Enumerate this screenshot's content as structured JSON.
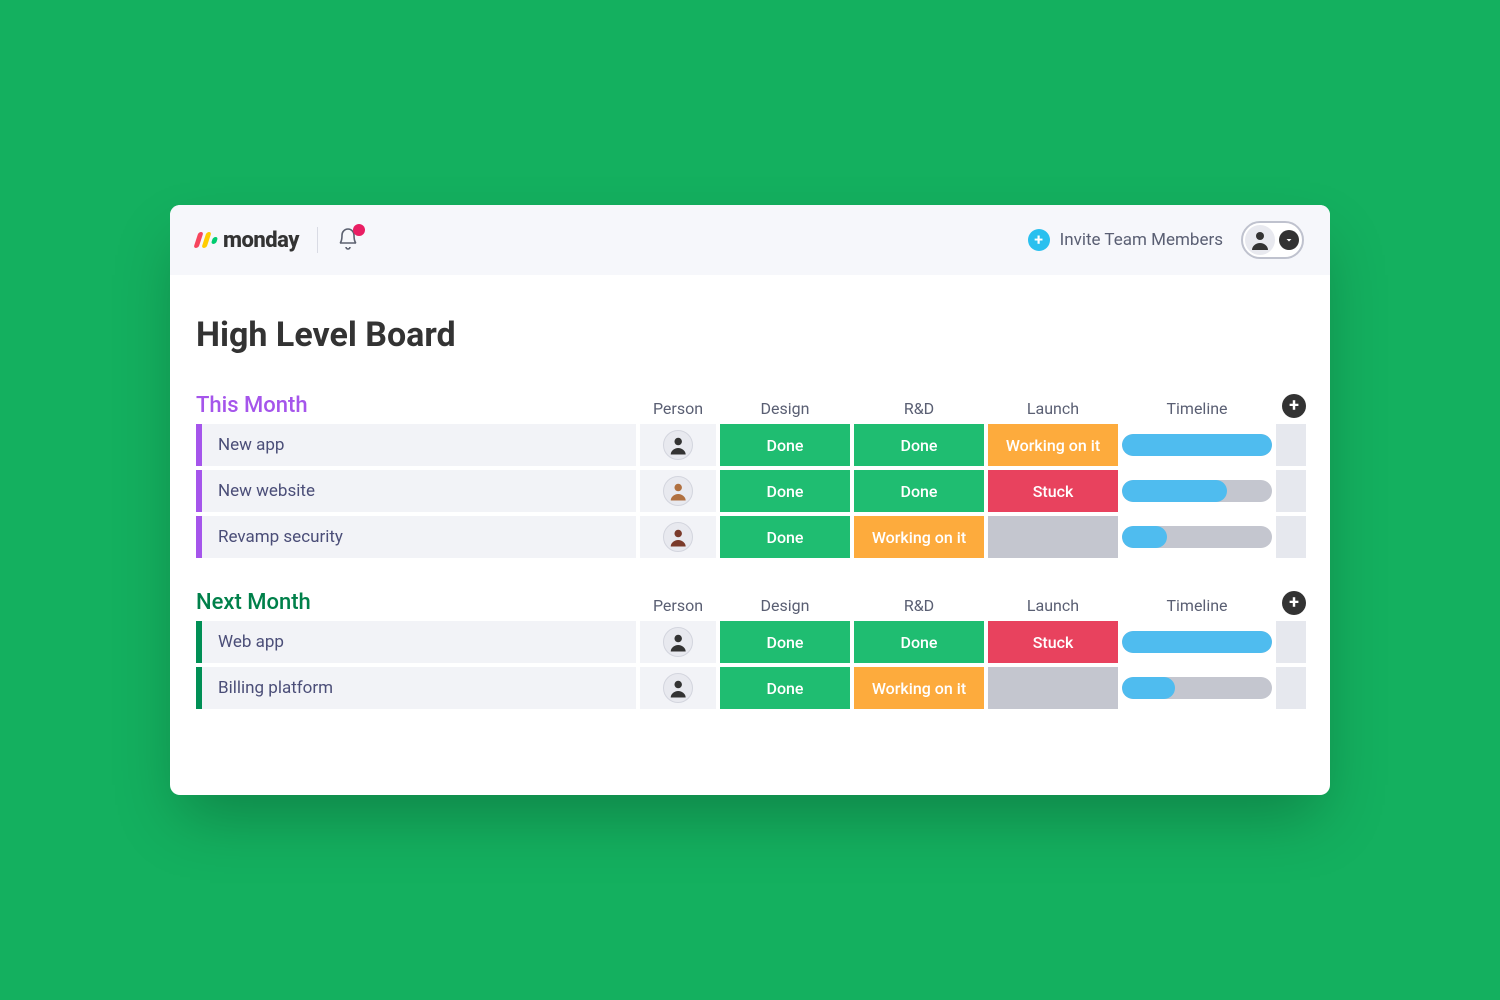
{
  "header": {
    "logo_text": "monday",
    "invite_label": "Invite Team Members"
  },
  "board": {
    "title": "High Level Board"
  },
  "columns": {
    "person": "Person",
    "design": "Design",
    "rnd": "R&D",
    "launch": "Launch",
    "timeline": "Timeline"
  },
  "status": {
    "done": "Done",
    "working": "Working on it",
    "stuck": "Stuck",
    "empty": ""
  },
  "groups": [
    {
      "title": "This Month",
      "color": "purple",
      "rows": [
        {
          "name": "New app",
          "design": "done",
          "rnd": "done",
          "launch": "working",
          "timeline_pct": 100
        },
        {
          "name": "New website",
          "design": "done",
          "rnd": "done",
          "launch": "stuck",
          "timeline_pct": 70
        },
        {
          "name": "Revamp security",
          "design": "done",
          "rnd": "working",
          "launch": "empty",
          "timeline_pct": 30
        }
      ]
    },
    {
      "title": "Next Month",
      "color": "green",
      "rows": [
        {
          "name": "Web app",
          "design": "done",
          "rnd": "done",
          "launch": "stuck",
          "timeline_pct": 100
        },
        {
          "name": "Billing platform",
          "design": "done",
          "rnd": "working",
          "launch": "empty",
          "timeline_pct": 35
        }
      ]
    }
  ]
}
